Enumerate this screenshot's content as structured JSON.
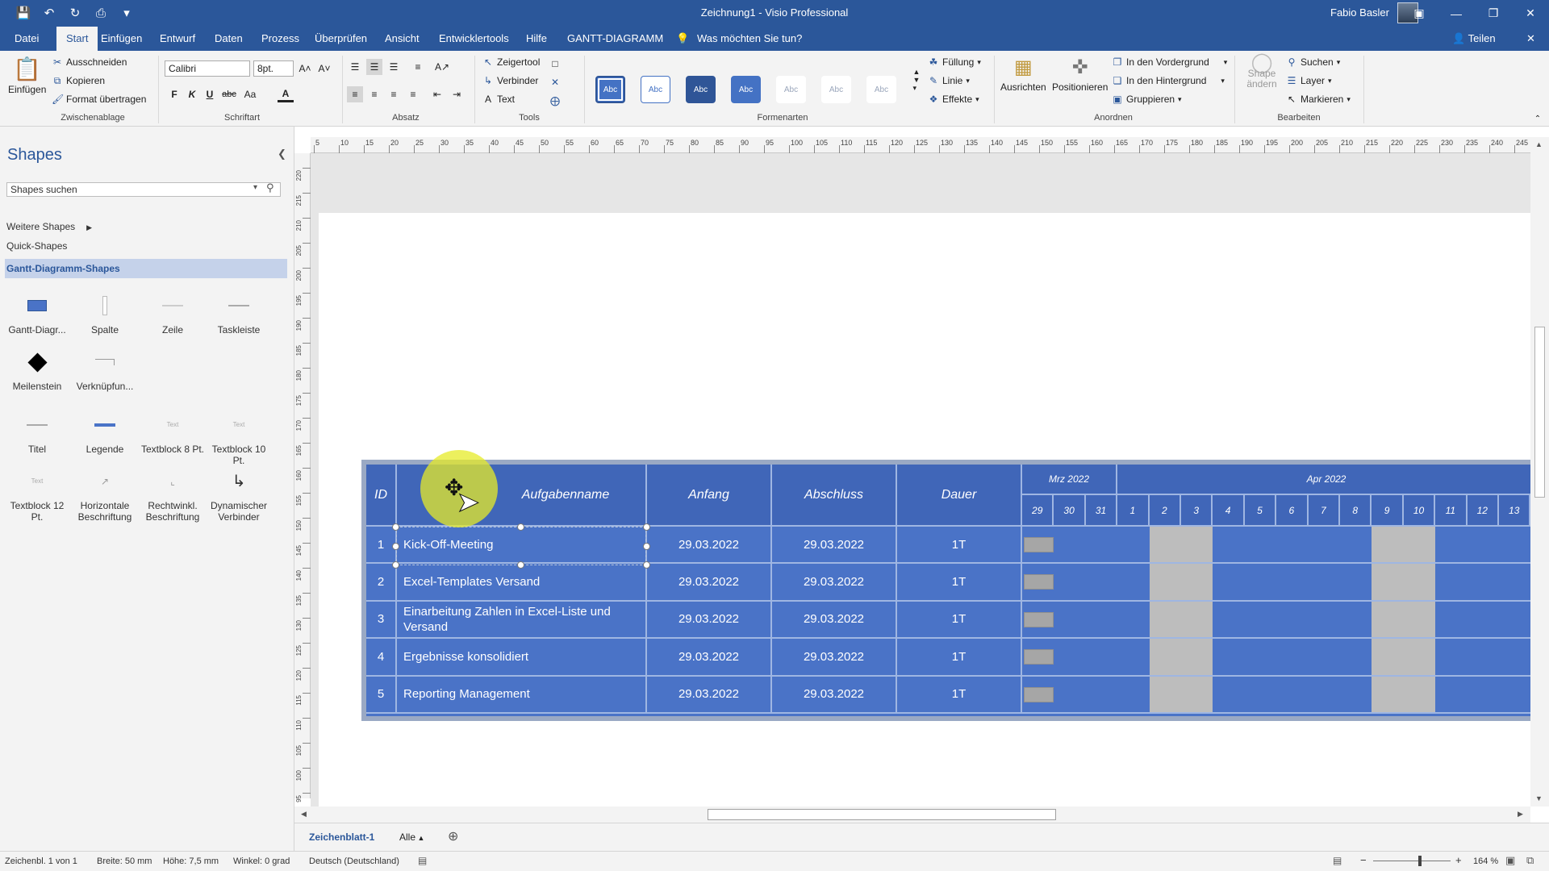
{
  "window": {
    "title": "Zeichnung1  -  Visio Professional",
    "user": "Fabio Basler"
  },
  "tabs": [
    "Datei",
    "Start",
    "Einfügen",
    "Entwurf",
    "Daten",
    "Prozess",
    "Überprüfen",
    "Ansicht",
    "Entwicklertools",
    "Hilfe",
    "GANTT-DIAGRAMM"
  ],
  "tell_me": "Was möchten Sie tun?",
  "share": "Teilen",
  "ribbon": {
    "clipboard": {
      "paste": "Einfügen",
      "cut": "Ausschneiden",
      "copy": "Kopieren",
      "format_painter": "Format übertragen",
      "label": "Zwischenablage"
    },
    "font": {
      "name": "Calibri",
      "size": "8pt.",
      "bold": "F",
      "italic": "K",
      "underline": "U",
      "strike": "abc",
      "case": "Aa",
      "label": "Schriftart"
    },
    "paragraph": {
      "label": "Absatz"
    },
    "tools": {
      "pointer": "Zeigertool",
      "connector": "Verbinder",
      "text": "Text",
      "label": "Tools"
    },
    "styles": {
      "sample": "Abc",
      "fill": "Füllung",
      "line": "Linie",
      "effects": "Effekte",
      "label": "Formenarten"
    },
    "arrange": {
      "align": "Ausrichten",
      "position": "Positionieren",
      "front": "In den Vordergrund",
      "back": "In den Hintergrund",
      "group": "Gruppieren",
      "label": "Anordnen"
    },
    "edit": {
      "change_shape": "Shape ändern",
      "find": "Suchen",
      "layer": "Layer",
      "select": "Markieren",
      "label": "Bearbeiten"
    }
  },
  "shapes_panel": {
    "title": "Shapes",
    "search_placeholder": "Shapes suchen",
    "more": "Weitere Shapes",
    "quick": "Quick-Shapes",
    "active_category": "Gantt-Diagramm-Shapes",
    "stencils": [
      {
        "name": "Gantt-Diagr...",
        "icon": "gantt-chart-icon"
      },
      {
        "name": "Spalte",
        "icon": "column-icon"
      },
      {
        "name": "Zeile",
        "icon": "row-icon"
      },
      {
        "name": "Taskleiste",
        "icon": "taskbar-icon"
      },
      {
        "name": "Meilenstein",
        "icon": "milestone-icon"
      },
      {
        "name": "Verknüpfun...",
        "icon": "link-icon"
      },
      {
        "name": "Titel",
        "icon": "title-icon"
      },
      {
        "name": "Legende",
        "icon": "legend-icon"
      },
      {
        "name": "Textblock 8 Pt.",
        "icon": "textblock-icon"
      },
      {
        "name": "Textblock 10 Pt.",
        "icon": "textblock-icon"
      },
      {
        "name": "Textblock 12 Pt.",
        "icon": "textblock-icon"
      },
      {
        "name": "Horizontale Beschriftung",
        "icon": "horizontal-label-icon"
      },
      {
        "name": "Rechtwinkl. Beschriftung",
        "icon": "angled-label-icon"
      },
      {
        "name": "Dynamischer Verbinder",
        "icon": "dynamic-connector-icon"
      }
    ]
  },
  "gantt": {
    "headers": {
      "id": "ID",
      "task": "Aufgabenname",
      "start": "Anfang",
      "end": "Abschluss",
      "duration": "Dauer"
    },
    "months": [
      "Mrz 2022",
      "Apr 2022"
    ],
    "days": [
      "29",
      "30",
      "31",
      "1",
      "2",
      "3",
      "4",
      "5",
      "6",
      "7",
      "8",
      "9",
      "10",
      "11",
      "12",
      "13"
    ],
    "rows": [
      {
        "id": "1",
        "task": "Kick-Off-Meeting",
        "start": "29.03.2022",
        "end": "29.03.2022",
        "duration": "1T"
      },
      {
        "id": "2",
        "task": "Excel-Templates Versand",
        "start": "29.03.2022",
        "end": "29.03.2022",
        "duration": "1T"
      },
      {
        "id": "3",
        "task": "Einarbeitung Zahlen in Excel-Liste und Versand",
        "start": "29.03.2022",
        "end": "29.03.2022",
        "duration": "1T"
      },
      {
        "id": "4",
        "task": "Ergebnisse konsolidiert",
        "start": "29.03.2022",
        "end": "29.03.2022",
        "duration": "1T"
      },
      {
        "id": "5",
        "task": "Reporting Management",
        "start": "29.03.2022",
        "end": "29.03.2022",
        "duration": "1T"
      }
    ]
  },
  "rulers": {
    "h": [
      "5",
      "10",
      "15",
      "20",
      "25",
      "30",
      "35",
      "40",
      "45",
      "50",
      "55",
      "60",
      "65",
      "70",
      "75",
      "80",
      "85",
      "90",
      "95",
      "100",
      "105",
      "110",
      "115",
      "120",
      "125",
      "130",
      "135",
      "140",
      "145",
      "150",
      "155",
      "160",
      "165",
      "170",
      "175",
      "180",
      "185",
      "190",
      "195",
      "200",
      "205",
      "210",
      "215",
      "220",
      "225",
      "230",
      "235",
      "240",
      "245"
    ],
    "v": [
      "220",
      "215",
      "210",
      "205",
      "200",
      "195",
      "190",
      "185",
      "180",
      "175",
      "170",
      "165",
      "160",
      "155",
      "150",
      "145",
      "140",
      "135",
      "130",
      "125",
      "120",
      "115",
      "110",
      "105",
      "100",
      "95"
    ]
  },
  "sheets": {
    "active": "Zeichenblatt-1",
    "all": "Alle"
  },
  "status": {
    "page": "Zeichenbl. 1 von 1",
    "width": "Breite: 50 mm",
    "height": "Höhe: 7,5 mm",
    "angle": "Winkel: 0 grad",
    "language": "Deutsch (Deutschland)",
    "zoom": "164 %"
  }
}
